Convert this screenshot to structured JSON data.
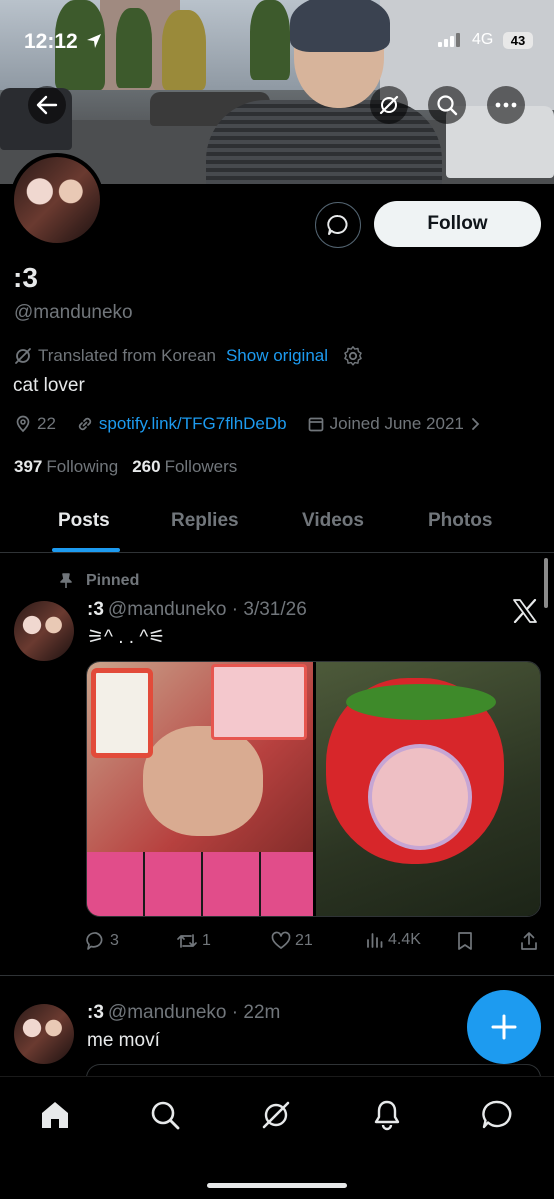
{
  "status_bar": {
    "time": "12:12",
    "network": "4G",
    "battery": "43"
  },
  "profile": {
    "display_name": ":3",
    "handle": "@manduneko",
    "translated_label": "Translated from Korean",
    "show_original": "Show original",
    "bio": "cat lover",
    "location": "22",
    "link": "spotify.link/TFG7flhDeDb",
    "joined": "Joined June 2021",
    "following_count": "397",
    "following_label": "Following",
    "followers_count": "260",
    "followers_label": "Followers",
    "follow_button": "Follow"
  },
  "tabs": [
    {
      "label": "Posts",
      "active": true
    },
    {
      "label": "Replies",
      "active": false
    },
    {
      "label": "Videos",
      "active": false
    },
    {
      "label": "Photos",
      "active": false
    }
  ],
  "posts": [
    {
      "pinned_label": "Pinned",
      "name": ":3",
      "handle": "@manduneko",
      "date": "3/31/26",
      "text": "⚞^ . . ^⚟",
      "replies": "3",
      "reposts": "1",
      "likes": "21",
      "views": "4.4K"
    },
    {
      "name": ":3",
      "handle": "@manduneko",
      "date": "22m",
      "text": "me moví"
    }
  ],
  "colors": {
    "accent": "#1d9bf0",
    "background": "#000000",
    "muted": "#71767b",
    "text": "#e7e9ea"
  },
  "icons": [
    "back-arrow-icon",
    "grok-icon",
    "search-icon",
    "more-icon",
    "message-icon",
    "translate-icon",
    "gear-icon",
    "location-icon",
    "link-icon",
    "calendar-icon",
    "pin-icon",
    "x-logo-icon",
    "reply-icon",
    "repost-icon",
    "like-icon",
    "views-icon",
    "bookmark-icon",
    "share-icon",
    "plus-icon",
    "home-icon",
    "explore-icon",
    "notifications-icon",
    "messages-icon"
  ]
}
